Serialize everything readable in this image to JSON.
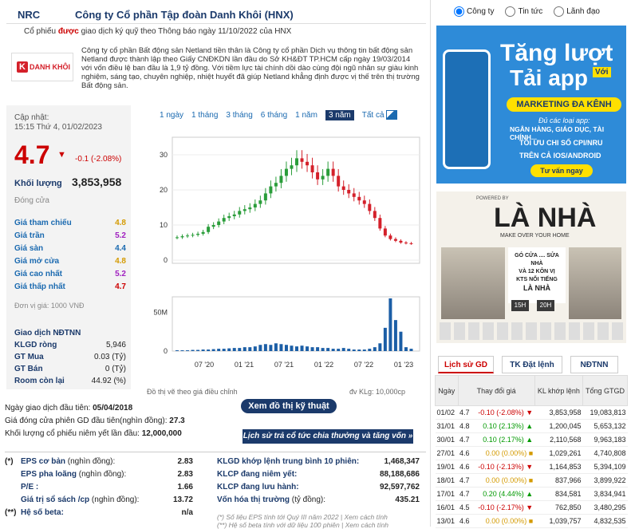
{
  "header": {
    "symbol": "NRC",
    "company": "Công ty Cổ phần Tập đoàn Danh Khôi (HNX)",
    "note_pre": "Cổ phiếu ",
    "note_bold": "được",
    "note_post": " giao dịch ký quỹ theo Thông báo ngày 11/10/2022 của HNX"
  },
  "logo": {
    "text": "DANH KHÔI"
  },
  "description": "Công ty cổ phần Bất động sản Netland tiền thân là Công ty cổ phần Dịch vụ thông tin bất động sản Netland được thành lập theo Giấy CNĐKDN lần đầu do Sở KH&ĐT TP.HCM cấp ngày 19/03/2014 với vốn điều lệ ban đầu là 1,9 tỷ đồng. Với tiềm lực tài chính dồi dào cùng đội ngũ nhân sự giàu kinh nghiệm, sáng tạo, chuyên nghiệp, nhiệt huyết đã giúp Netland khẳng định được vị thế trên thị trường Bất động sản.",
  "quote": {
    "updated_label": "Cập nhật:",
    "updated": "15:15 Thứ 4, 01/02/2023",
    "price": "4.7",
    "change": "-0.1 (-2.08%)",
    "volume_label": "Khối lượng",
    "volume": "3,853,958",
    "close_label": "Đóng cửa",
    "rows": [
      {
        "label": "Giá tham chiếu",
        "value": "4.8",
        "color": "#d49a00"
      },
      {
        "label": "Giá trần",
        "value": "5.2",
        "color": "#a020c0"
      },
      {
        "label": "Giá sàn",
        "value": "4.4",
        "color": "#1b6ab0"
      },
      {
        "label": "Giá mở cửa",
        "value": "4.8",
        "color": "#d49a00"
      },
      {
        "label": "Giá cao nhất",
        "value": "5.2",
        "color": "#a020c0"
      },
      {
        "label": "Giá thấp nhất",
        "value": "4.7",
        "color": "#c00"
      }
    ],
    "unit": "Đơn vị giá: 1000 VNĐ",
    "ndtnn": [
      {
        "label": "Giao dịch NĐTNN",
        "value": ""
      },
      {
        "label": "KLGD ròng",
        "value": "5,946"
      },
      {
        "label": "GT Mua",
        "value": "0.03 (Tỷ)"
      },
      {
        "label": "GT Bán",
        "value": "0 (Tỷ)"
      },
      {
        "label": "Room còn lại",
        "value": "44.92 (%)"
      }
    ]
  },
  "chart_periods": [
    "1 ngày",
    "1 tháng",
    "3 tháng",
    "6 tháng",
    "1 năm",
    "3 năm",
    "Tất cả"
  ],
  "chart_data": {
    "type": "candlestick",
    "price_ticks": [
      "30",
      "20",
      "10",
      "0"
    ],
    "volume_ticks": [
      "50M",
      "0"
    ],
    "xticks": [
      "07 '20",
      "01 '21",
      "07 '21",
      "01 '22",
      "07 '22",
      "01 '23"
    ],
    "close": [
      6.5,
      6.8,
      7,
      7.2,
      7.5,
      8,
      9.5,
      10,
      11,
      12,
      12.5,
      13,
      14,
      14.5,
      15,
      16,
      17,
      19,
      21,
      22,
      24,
      26,
      27,
      29,
      28,
      27,
      25,
      23,
      24,
      26,
      24,
      21,
      20,
      19,
      18,
      17,
      16,
      14,
      12,
      9,
      7,
      6,
      5.5,
      5,
      4.8,
      4.7
    ],
    "volume": [
      1,
      1,
      1,
      1.5,
      1.5,
      2,
      2,
      2.5,
      3,
      3,
      3.5,
      4,
      4,
      5,
      5,
      6,
      8,
      9,
      8,
      10,
      9,
      8,
      7,
      6,
      7,
      6,
      5,
      5,
      4,
      4,
      3,
      3,
      4,
      3,
      2,
      2,
      2,
      3,
      5,
      10,
      30,
      68,
      40,
      25,
      5,
      3
    ],
    "note_left": "Đồ thị vẽ theo giá điều chỉnh",
    "note_right": "đv KLg: 10,000cp"
  },
  "tech_button": "Xem đồ thị kỹ thuật",
  "info": [
    {
      "label": "Ngày giao dịch đầu tiên:",
      "value": "05/04/2018"
    },
    {
      "label": "Giá đóng cửa phiên GD đầu tiên(nghìn đồng):",
      "value": "27.3"
    },
    {
      "label": "Khối lượng cổ phiếu niêm yết lần đầu:",
      "value": "12,000,000"
    }
  ],
  "history_button": "Lịch sử trả cổ tức chia thưởng và tăng vốn »",
  "fin_left": [
    {
      "mark": "(*)",
      "label": "EPS cơ bản",
      "sub": " (nghìn đồng):",
      "value": "2.83"
    },
    {
      "mark": "",
      "label": "EPS pha loãng",
      "sub": " (nghìn đồng):",
      "value": "2.83"
    },
    {
      "mark": "",
      "label": "P/E :",
      "sub": "",
      "value": "1.66"
    },
    {
      "mark": "",
      "label": "Giá trị sổ sách /cp",
      "sub": " (nghìn đồng):",
      "value": "13.72"
    },
    {
      "mark": "(**)",
      "label": "Hệ số beta:",
      "sub": "",
      "value": "n/a"
    }
  ],
  "fin_right": [
    {
      "label": "KLGD khớp lệnh trung bình 10 phiên:",
      "value": "1,468,347"
    },
    {
      "label": "KLCP đang niêm yết:",
      "value": "88,188,686"
    },
    {
      "label": "KLCP đang lưu hành:",
      "value": "92,597,762"
    },
    {
      "label": "Vốn hóa thị trường",
      "sub": " (tỷ đồng):",
      "value": "435.21"
    }
  ],
  "fin_note1": "(*) Số liệu EPS tính tới Quý III năm 2022 | Xem cách tính",
  "fin_note2": "(**) Hệ số beta tính với dữ liệu 100 phiên | Xem cách tính",
  "radios": [
    "Công ty",
    "Tin tức",
    "Lãnh đạo"
  ],
  "ad1": {
    "l1": "Tăng lượt",
    "l2": "Tải app",
    "l3": "Với",
    "l4": "MARKETING ĐA KÊNH",
    "l5": "Đủ các loại app:",
    "l6": "NGÂN HÀNG, GIÁO DỤC, TÀI CHÍNH...",
    "l7": "TỐI ƯU CHI SỐ CPI/NRU",
    "l8": "TRÊN CẢ IOS/ANDROID",
    "l9": "Tư vấn ngay"
  },
  "ad2": {
    "top": "POWERED BY",
    "title": "LÀ NHÀ",
    "sub": "MAKE OVER YOUR HOME",
    "b1": "GÓ CỬA .... SỬA NHÀ",
    "b2": "VÀ 12 KÔN VỊ",
    "b3": "KTS NỔI TIẾNG",
    "b4": "LÀ NHÀ",
    "t1": "15H",
    "t2": "20H"
  },
  "tabs": [
    "Lịch sử GD",
    "TK Đặt lệnh",
    "NĐTNN"
  ],
  "gd_head": [
    "Ngày",
    "Thay đổi giá",
    "KL khớp lệnh",
    "Tổng GTGD"
  ],
  "gd_rows": [
    [
      "01/02",
      "4.7",
      "-0.10 (-2.08%)",
      "3,853,958",
      "19,083,813",
      "neg"
    ],
    [
      "31/01",
      "4.8",
      "0.10 (2.13%)",
      "1,200,045",
      "5,653,132",
      "pos"
    ],
    [
      "30/01",
      "4.7",
      "0.10 (2.17%)",
      "2,110,568",
      "9,963,183",
      "pos"
    ],
    [
      "27/01",
      "4.6",
      "0.00 (0.00%)",
      "1,029,261",
      "4,740,808",
      "zero"
    ],
    [
      "19/01",
      "4.6",
      "-0.10 (-2.13%)",
      "1,164,853",
      "5,394,109",
      "neg"
    ],
    [
      "18/01",
      "4.7",
      "0.00 (0.00%)",
      "837,966",
      "3,899,922",
      "zero"
    ],
    [
      "17/01",
      "4.7",
      "0.20 (4.44%)",
      "834,581",
      "3,834,941",
      "pos"
    ],
    [
      "16/01",
      "4.5",
      "-0.10 (-2.17%)",
      "762,850",
      "3,480,295",
      "neg"
    ],
    [
      "13/01",
      "4.6",
      "0.00 (0.00%)",
      "1,039,757",
      "4,832,535",
      "zero"
    ]
  ]
}
